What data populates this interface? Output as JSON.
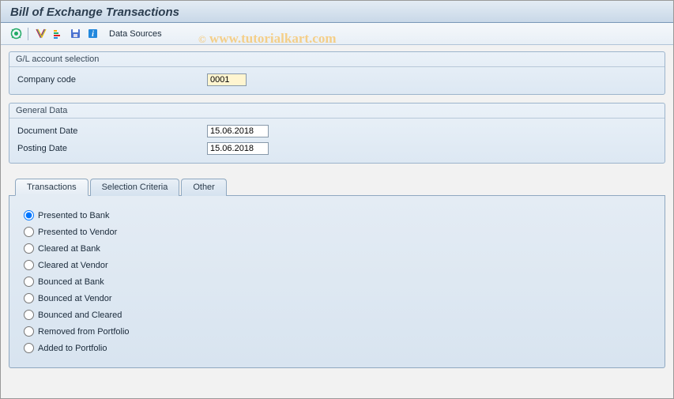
{
  "title": "Bill of Exchange Transactions",
  "toolbar": {
    "data_sources": "Data Sources"
  },
  "watermark": {
    "copy": "©",
    "text": "www.tutorialkart.com"
  },
  "groups": {
    "gl": {
      "title": "G/L account selection",
      "company_code_label": "Company code",
      "company_code_value": "0001"
    },
    "general": {
      "title": "General Data",
      "doc_date_label": "Document Date",
      "doc_date_value": "15.06.2018",
      "post_date_label": "Posting Date",
      "post_date_value": "15.06.2018"
    }
  },
  "tabs": {
    "t1": "Transactions",
    "t2": "Selection Criteria",
    "t3": "Other"
  },
  "radios": {
    "r1": "Presented to Bank",
    "r2": "Presented to Vendor",
    "r3": "Cleared at Bank",
    "r4": "Cleared at Vendor",
    "r5": "Bounced at Bank",
    "r6": "Bounced at Vendor",
    "r7": "Bounced and Cleared",
    "r8": "Removed from Portfolio",
    "r9": "Added to Portfolio"
  }
}
